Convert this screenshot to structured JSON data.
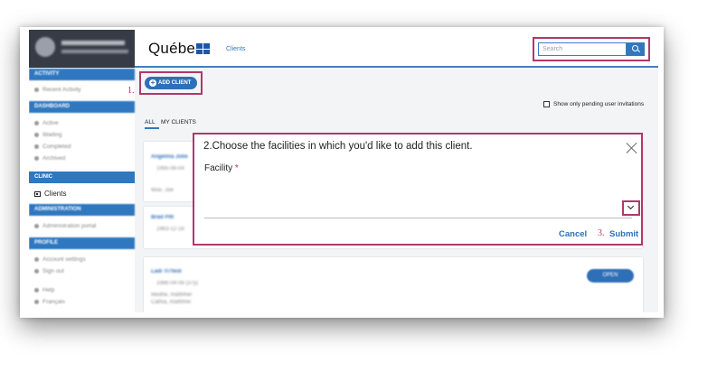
{
  "topbar": {
    "logo": "Québec",
    "nav_clients": "Clients",
    "search_placeholder": "Search"
  },
  "sidebar": {
    "user_name": "ADMIN ADMINISTRATOR",
    "user_email": "super.test+admin@test.ca",
    "sections": [
      {
        "label": "ACTIVITY"
      },
      {
        "label": "DASHBOARD"
      },
      {
        "label": "CLINIC"
      },
      {
        "label": "ADMINISTRATION"
      },
      {
        "label": "PROFILE"
      }
    ],
    "items": {
      "recent_activity": "Recent Activity",
      "active": "Active",
      "waiting": "Waiting",
      "completed": "Completed",
      "archived": "Archived",
      "clients": "Clients",
      "admin_portal": "Administration portal",
      "account_settings": "Account settings",
      "sign_out": "Sign out",
      "help": "Help",
      "francais": "Français"
    }
  },
  "main": {
    "add_client_label": "ADD CLIENT",
    "step1": "1.",
    "pending_label": "Show only pending user invitations",
    "tabs": [
      "ALL",
      "MY CLIENTS"
    ],
    "cards": [
      {
        "name": "Angelina Jolie",
        "line1": "1995-06-04",
        "line2": "Moe, Joe"
      },
      {
        "name": "Brad Pitt",
        "line1": "1963-12-18"
      },
      {
        "name": "Ladi Tr7test",
        "line1": "1986-04-08 (37y)",
        "line2": "Medhe, mafthher",
        "line3": "Cathia, mafthher",
        "open": "OPEN"
      }
    ]
  },
  "dialog": {
    "title": "2.Choose the facilities in which you'd like to add this client.",
    "facility_label": "Facility",
    "required_mark": "*",
    "cancel": "Cancel",
    "step3": "3.",
    "submit": "Submit"
  },
  "colors": {
    "accent": "#2f78c0",
    "annotation": "#b0386a",
    "sidebar_dark": "#363b45"
  }
}
